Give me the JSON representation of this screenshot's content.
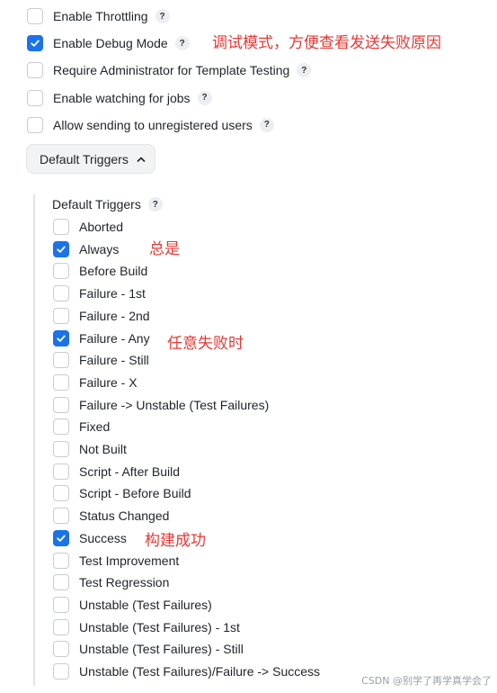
{
  "options": [
    {
      "label": "Enable Throttling",
      "checked": false
    },
    {
      "label": "Enable Debug Mode",
      "checked": true
    },
    {
      "label": "Require Administrator for Template Testing",
      "checked": false
    },
    {
      "label": "Enable watching for jobs",
      "checked": false
    },
    {
      "label": "Allow sending to unregistered users",
      "checked": false
    }
  ],
  "help_glyph": "?",
  "toggle": {
    "label": "Default Triggers"
  },
  "triggers_title": "Default Triggers",
  "triggers": [
    {
      "label": "Aborted",
      "checked": false
    },
    {
      "label": "Always",
      "checked": true
    },
    {
      "label": "Before Build",
      "checked": false
    },
    {
      "label": "Failure - 1st",
      "checked": false
    },
    {
      "label": "Failure - 2nd",
      "checked": false
    },
    {
      "label": "Failure - Any",
      "checked": true
    },
    {
      "label": "Failure - Still",
      "checked": false
    },
    {
      "label": "Failure - X",
      "checked": false
    },
    {
      "label": "Failure -> Unstable (Test Failures)",
      "checked": false
    },
    {
      "label": "Fixed",
      "checked": false
    },
    {
      "label": "Not Built",
      "checked": false
    },
    {
      "label": "Script - After Build",
      "checked": false
    },
    {
      "label": "Script - Before Build",
      "checked": false
    },
    {
      "label": "Status Changed",
      "checked": false
    },
    {
      "label": "Success",
      "checked": true
    },
    {
      "label": "Test Improvement",
      "checked": false
    },
    {
      "label": "Test Regression",
      "checked": false
    },
    {
      "label": "Unstable (Test Failures)",
      "checked": false
    },
    {
      "label": "Unstable (Test Failures) - 1st",
      "checked": false
    },
    {
      "label": "Unstable (Test Failures) - Still",
      "checked": false
    },
    {
      "label": "Unstable (Test Failures)/Failure -> Success",
      "checked": false
    }
  ],
  "annotations": {
    "debug": "调试模式，方便查看发送失败原因",
    "always": "总是",
    "failure_any": "任意失败时",
    "success": "构建成功"
  },
  "watermark": "CSDN @别学了再学真学会了",
  "colors": {
    "accent": "#1a73e8",
    "annotation": "#e53935"
  }
}
